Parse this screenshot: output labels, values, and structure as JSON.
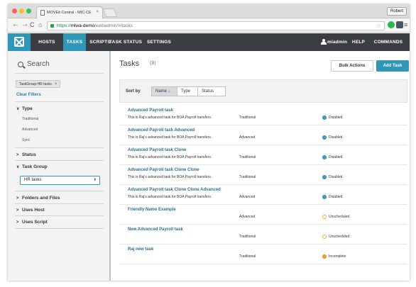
{
  "browser": {
    "tab_title": "MOVEit Central - MIC-CE",
    "tab_close": "×",
    "profile": "Robert",
    "url_scheme": "https://",
    "url_host": "mlwa-demo",
    "url_path": "/webadmin/#/tasks"
  },
  "nav": {
    "items": [
      "HOSTS",
      "TASKS",
      "SCRIPTS",
      "TASK STATUS",
      "SETTINGS"
    ],
    "active": "TASKS",
    "user": "miadmin",
    "help": "HELP",
    "commands": "COMMANDS"
  },
  "sidebar": {
    "search_label": "Search",
    "active_filter": "TaskGroup:HR tasks",
    "filter_close": "×",
    "clear_filters": "Clear Filters",
    "type_section": "Type",
    "type_options": [
      "Traditional",
      "Advanced",
      "Sync"
    ],
    "status_section": "Status",
    "task_group_section": "Task Group",
    "task_group_selected": "HR tasks",
    "folders_section": "Folders and Files",
    "uses_host_section": "Uses Host",
    "uses_script_section": "Uses Script",
    "chevron_open": "∨",
    "chevron_closed": ">"
  },
  "main": {
    "title": "Tasks",
    "count": "(8)",
    "bulk_actions": "Bulk Actions",
    "add_task": "Add Task",
    "sort_label": "Sort by",
    "sort_options": [
      "Name ↓",
      "Type",
      "Status"
    ],
    "tasks": [
      {
        "name": "Advanced Payroll task",
        "desc": "This is Raj's advanced task for BOA Payroll transfers.",
        "type": "Traditional",
        "status": "Disabled"
      },
      {
        "name": "Advanced Payroll task Advanced",
        "desc": "This is Raj's advanced task for BOA Payroll transfers.",
        "type": "Advanced",
        "status": "Disabled"
      },
      {
        "name": "Advanced Payroll task Clone",
        "desc": "This is Raj's advanced task for BOA Payroll transfers.",
        "type": "Traditional",
        "status": "Disabled"
      },
      {
        "name": "Advanced Payroll task Clone Clone",
        "desc": "This is Raj's advanced task for BOA Payroll transfers.",
        "type": "Traditional",
        "status": "Disabled"
      },
      {
        "name": "Advanced Payroll task Clone Clone Advanced",
        "desc": "This is Raj's advanced task for BOA Payroll transfers.",
        "type": "Advanced",
        "status": "Disabled"
      },
      {
        "name": "Friendly Name Example",
        "desc": "",
        "type": "Advanced",
        "status": "Unscheduled"
      },
      {
        "name": "New Advanced Payroll task",
        "desc": "",
        "type": "Traditional",
        "status": "Unscheduled"
      },
      {
        "name": "Raj new task",
        "desc": "",
        "type": "Traditional",
        "status": "Incomplete"
      }
    ]
  },
  "colors": {
    "accent": "#3097b8",
    "header": "#3a3d42",
    "disabled": "#3fa3cf",
    "unscheduled": "#f0ad2d",
    "incomplete": "#f0a52a"
  }
}
